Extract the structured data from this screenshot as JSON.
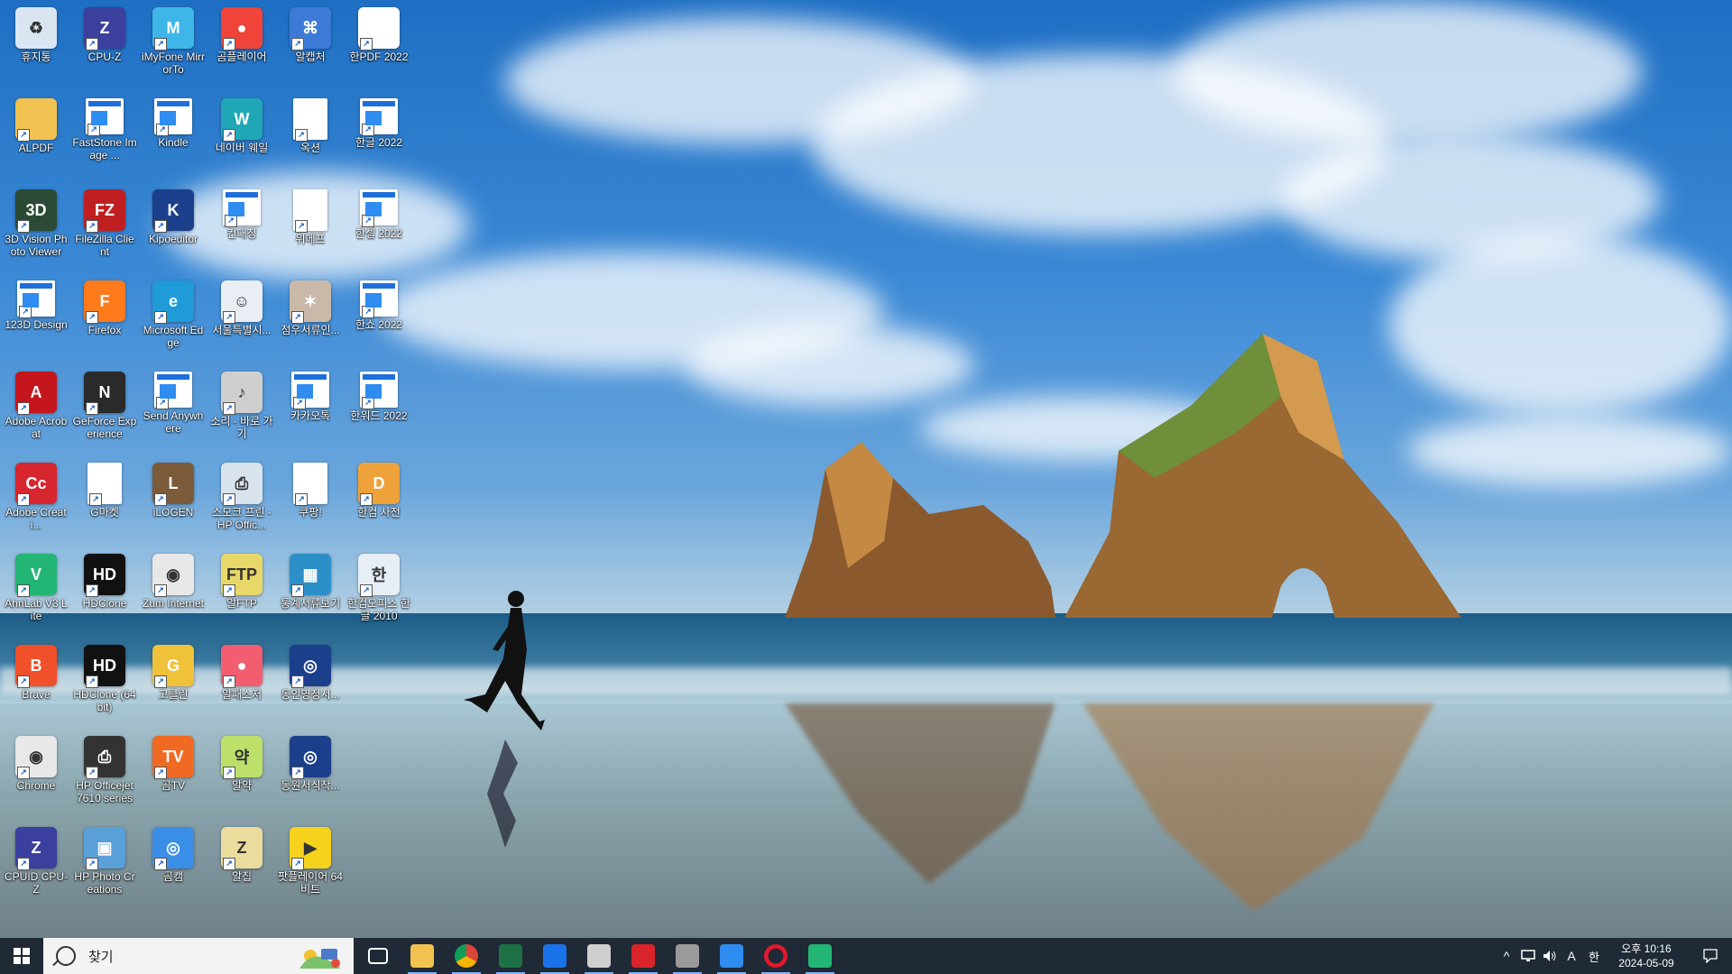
{
  "desktop": {
    "icons": [
      {
        "label": "휴지통",
        "icon": "recycle-bin-icon",
        "color": "#d9e6f2"
      },
      {
        "label": "CPU-Z",
        "icon": "cpu-z-icon",
        "color": "#3b3f9e"
      },
      {
        "label": "iMyFone MirrorTo",
        "icon": "imyfone-icon",
        "color": "#3fb6e8"
      },
      {
        "label": "곰플레이어",
        "icon": "gom-player-icon",
        "color": "#f0433a"
      },
      {
        "label": "알캡처",
        "icon": "alcapture-icon",
        "color": "#3d7ad8"
      },
      {
        "label": "한PDF 2022",
        "icon": "hanpdf-icon",
        "color": "#ffffff"
      },
      {
        "label": "ALPDF",
        "icon": "folder-icon",
        "color": "#f1c24f"
      },
      {
        "label": "FastStone Image ...",
        "icon": "window-icon",
        "color": "#ffffff"
      },
      {
        "label": "Kindle",
        "icon": "window-icon",
        "color": "#ffffff"
      },
      {
        "label": "네이버 웨일",
        "icon": "naver-whale-icon",
        "color": "#1fa7b7"
      },
      {
        "label": "옥션",
        "icon": "document-icon",
        "color": "#ffffff"
      },
      {
        "label": "한글 2022",
        "icon": "window-icon",
        "color": "#ffffff"
      },
      {
        "label": "3D Vision Photo Viewer",
        "icon": "3d-vision-icon",
        "color": "#2b4a35"
      },
      {
        "label": "FileZilla Client",
        "icon": "filezilla-icon",
        "color": "#bf1f20"
      },
      {
        "label": "Kipoeditor",
        "icon": "kipo-icon",
        "color": "#1c3f8c"
      },
      {
        "label": "컨대칭",
        "icon": "window-icon",
        "color": "#ffffff"
      },
      {
        "label": "위메프",
        "icon": "document-icon",
        "color": "#ffffff"
      },
      {
        "label": "한셀 2022",
        "icon": "window-icon",
        "color": "#ffffff"
      },
      {
        "label": "123D Design",
        "icon": "window-icon",
        "color": "#ffffff"
      },
      {
        "label": "Firefox",
        "icon": "firefox-icon",
        "color": "#ff7a1a"
      },
      {
        "label": "Microsoft Edge",
        "icon": "edge-icon",
        "color": "#1f9bd8"
      },
      {
        "label": "서울특별시...",
        "icon": "people-icon",
        "color": "#e9eef5"
      },
      {
        "label": "점우서류인...",
        "icon": "spider-icon",
        "color": "#c9b9a9"
      },
      {
        "label": "한쇼 2022",
        "icon": "window-icon",
        "color": "#ffffff"
      },
      {
        "label": "Adobe Acrobat",
        "icon": "acrobat-icon",
        "color": "#c4161c"
      },
      {
        "label": "GeForce Experience",
        "icon": "nvidia-icon",
        "color": "#2a2a2a"
      },
      {
        "label": "Send Anywhere",
        "icon": "window-icon",
        "color": "#ffffff"
      },
      {
        "label": "소리 - 바로 가기",
        "icon": "speaker-icon",
        "color": "#cfcfcf"
      },
      {
        "label": "카카오톡",
        "icon": "window-icon",
        "color": "#ffffff"
      },
      {
        "label": "한워드 2022",
        "icon": "window-icon",
        "color": "#ffffff"
      },
      {
        "label": "Adobe Creati...",
        "icon": "creative-cloud-icon",
        "color": "#d7262f"
      },
      {
        "label": "G마켓",
        "icon": "document-icon",
        "color": "#ffffff"
      },
      {
        "label": "iLOGEN",
        "icon": "ilogen-icon",
        "color": "#7b5b3a"
      },
      {
        "label": "스모크 프린 - HP Offic...",
        "icon": "printer-icon",
        "color": "#d8e3ee"
      },
      {
        "label": "쿠팡!",
        "icon": "document-icon",
        "color": "#ffffff"
      },
      {
        "label": "한컴 사전",
        "icon": "hancom-dict-icon",
        "color": "#f0a23a"
      },
      {
        "label": "AhnLab V3 Lite",
        "icon": "ahnlab-icon",
        "color": "#22b573"
      },
      {
        "label": "HDClone",
        "icon": "hdclone-icon",
        "color": "#111111"
      },
      {
        "label": "Zum Internet",
        "icon": "chrome-icon",
        "color": "#e8e8e8"
      },
      {
        "label": "알FTP",
        "icon": "alftp-icon",
        "color": "#e8d86a"
      },
      {
        "label": "통계서류보기",
        "icon": "stats-icon",
        "color": "#2d8fc8"
      },
      {
        "label": "한컴오피스 한글 2010",
        "icon": "hancom-icon",
        "color": "#e8eef6"
      },
      {
        "label": "Brave",
        "icon": "brave-icon",
        "color": "#f0502a"
      },
      {
        "label": "HDClone (64bit)",
        "icon": "hdclone-icon",
        "color": "#111111"
      },
      {
        "label": "고클린",
        "icon": "goclean-icon",
        "color": "#f0c23a"
      },
      {
        "label": "알패스저",
        "icon": "alpass-icon",
        "color": "#f25d6f"
      },
      {
        "label": "동인영정서...",
        "icon": "gov-icon",
        "color": "#1c3f8c"
      },
      {
        "label": "",
        "icon": "none",
        "color": "transparent"
      },
      {
        "label": "Chrome",
        "icon": "chrome-icon",
        "color": "#e8e8e8"
      },
      {
        "label": "HP Officejet 7610 series",
        "icon": "printer-icon",
        "color": "#333333"
      },
      {
        "label": "곰TV",
        "icon": "gomtv-icon",
        "color": "#f06a23"
      },
      {
        "label": "알약",
        "icon": "alyac-icon",
        "color": "#bde06a"
      },
      {
        "label": "동원서식작...",
        "icon": "gov-icon",
        "color": "#1c3f8c"
      },
      {
        "label": "",
        "icon": "none",
        "color": "transparent"
      },
      {
        "label": "CPUID CPU-Z",
        "icon": "cpu-z-icon",
        "color": "#3b3f9e"
      },
      {
        "label": "HP Photo Creations",
        "icon": "photo-icon",
        "color": "#5aa0d8"
      },
      {
        "label": "곰캠",
        "icon": "gomcam-icon",
        "color": "#3a8ee8"
      },
      {
        "label": "알집",
        "icon": "alzip-icon",
        "color": "#eadc9c"
      },
      {
        "label": "팟플레이어 64 비트",
        "icon": "potplayer-icon",
        "color": "#f7d21c"
      },
      {
        "label": "",
        "icon": "none",
        "color": "transparent"
      }
    ]
  },
  "taskbar": {
    "search_placeholder": "찾기",
    "apps": [
      {
        "name": "task-view",
        "icon": "task-view-icon",
        "color": "#ffffff"
      },
      {
        "name": "file-explorer",
        "icon": "folder-icon",
        "color": "#f1c24f"
      },
      {
        "name": "chrome",
        "icon": "chrome-icon",
        "color": "#4a8af4"
      },
      {
        "name": "excel",
        "icon": "excel-icon",
        "color": "#1d7144"
      },
      {
        "name": "zoom-capture",
        "icon": "capture-icon",
        "color": "#1a73e8"
      },
      {
        "name": "paint",
        "icon": "paint-icon",
        "color": "#cfcfcf"
      },
      {
        "name": "calendar",
        "icon": "calendar-icon",
        "color": "#d8242a"
      },
      {
        "name": "usb-tool",
        "icon": "usb-icon",
        "color": "#9a9a9a"
      },
      {
        "name": "window-app",
        "icon": "window-icon",
        "color": "#2f8cf0"
      },
      {
        "name": "opera",
        "icon": "opera-icon",
        "color": "#e3172d"
      },
      {
        "name": "ahnlab",
        "icon": "ahnlab-icon",
        "color": "#22b573"
      }
    ],
    "tray": {
      "chevron": "^",
      "ime_label": "A",
      "korean_label": "한",
      "clock_time": "오후 10:16",
      "clock_date": "2024-05-09"
    }
  }
}
